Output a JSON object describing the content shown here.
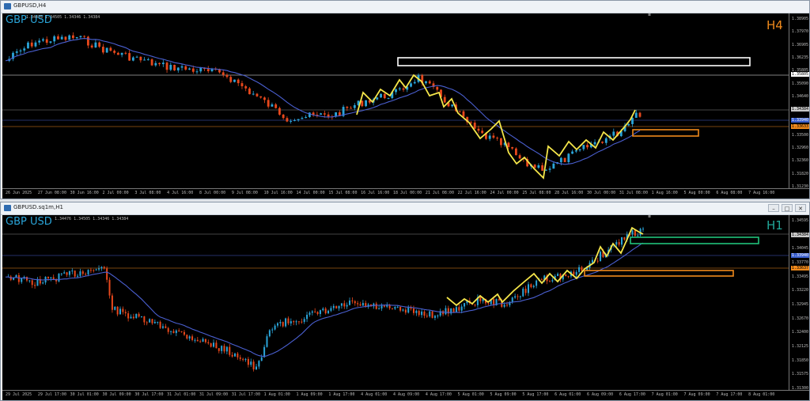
{
  "windows": [
    {
      "title": "GBPUSD,H4",
      "symbol": "GBP USD",
      "ohlc": "1.34476 1.34505 1.34346 1.34384",
      "timeframe": "H4",
      "timeframe_color": "#f08a1c",
      "price_ticks": [
        "1.38905",
        "1.37970",
        "1.36905",
        "1.36235",
        "1.35805",
        "1.35090",
        "1.34640",
        "1.34384",
        "1.33940",
        "1.33500",
        "1.32960",
        "1.32360",
        "1.31820",
        "1.31230"
      ],
      "price_tags": [
        {
          "text": "1.35805",
          "bg": "#ffffff",
          "fg": "#000000"
        },
        {
          "text": "1.34384",
          "bg": "#c8c8c8",
          "fg": "#000000"
        },
        {
          "text": "1.33940",
          "bg": "#3a5fcd",
          "fg": "#ffffff"
        },
        {
          "text": "1.33633",
          "bg": "#f08a1c",
          "fg": "#000000"
        }
      ],
      "time_ticks": [
        "26 Jun 2025",
        "27 Jun 08:00",
        "30 Jun 16:00",
        "2 Jul 00:00",
        "3 Jul 08:00",
        "4 Jul 16:00",
        "8 Jul 00:00",
        "9 Jul 08:00",
        "10 Jul 16:00",
        "14 Jul 00:00",
        "15 Jul 08:00",
        "16 Jul 16:00",
        "18 Jul 00:00",
        "21 Jul 08:00",
        "22 Jul 16:00",
        "24 Jul 00:00",
        "25 Jul 08:00",
        "28 Jul 16:00",
        "30 Jul 00:00",
        "31 Jul 08:00",
        "1 Aug 16:00",
        "5 Aug 00:00",
        "6 Aug 08:00",
        "7 Aug 16:00"
      ]
    },
    {
      "title": "GBPUSD.sq1m,H1",
      "symbol": "GBP USD",
      "ohlc": "1.34476 1.34505 1.34346 1.34384",
      "timeframe": "H1",
      "timeframe_color": "#21a89a",
      "price_ticks": [
        "1.34595",
        "1.34384",
        "1.34045",
        "1.33770",
        "1.33495",
        "1.33220",
        "1.32945",
        "1.32670",
        "1.32400",
        "1.32125",
        "1.31850",
        "1.31575",
        "1.31300"
      ],
      "price_tags": [
        {
          "text": "1.34384",
          "bg": "#c8c8c8",
          "fg": "#000000"
        },
        {
          "text": "1.33940",
          "bg": "#3a5fcd",
          "fg": "#ffffff"
        },
        {
          "text": "1.33637",
          "bg": "#f08a1c",
          "fg": "#000000"
        }
      ],
      "time_ticks": [
        "29 Jul 2025",
        "29 Jul 17:00",
        "30 Jul 01:00",
        "30 Jul 09:00",
        "30 Jul 17:00",
        "31 Jul 01:00",
        "31 Jul 09:00",
        "31 Jul 17:00",
        "1 Aug 01:00",
        "1 Aug 09:00",
        "1 Aug 17:00",
        "4 Aug 01:00",
        "4 Aug 09:00",
        "4 Aug 17:00",
        "5 Aug 01:00",
        "5 Aug 09:00",
        "5 Aug 17:00",
        "6 Aug 01:00",
        "6 Aug 09:00",
        "6 Aug 17:00",
        "7 Aug 01:00",
        "7 Aug 09:00",
        "7 Aug 17:00",
        "8 Aug 01:00"
      ]
    }
  ],
  "colors": {
    "bull": "#2aa4d8",
    "bear": "#e8481c",
    "ma": "#4a5fd0",
    "zigzag": "#f5e64a",
    "resistance": "#ffffff",
    "support_orange": "#f08a1c",
    "zone_green": "#21c27a"
  },
  "icons": {
    "app": "chart-window-icon",
    "minimize": "minimize-icon",
    "maximize": "maximize-icon",
    "close": "close-icon"
  }
}
